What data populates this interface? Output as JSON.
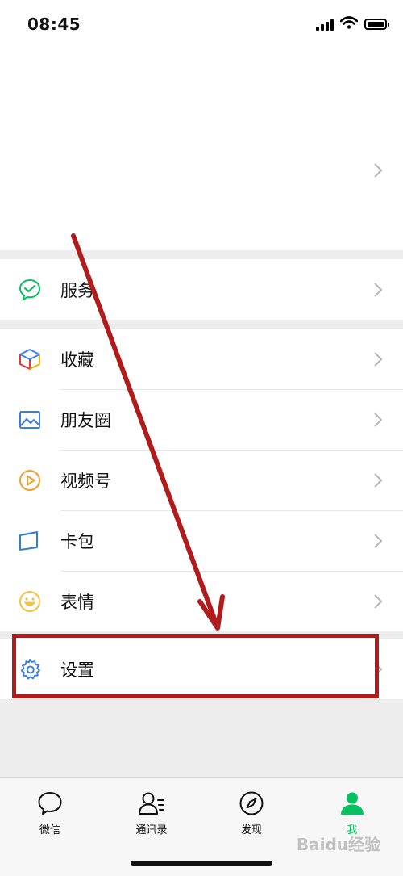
{
  "status_bar": {
    "time": "08:45"
  },
  "menu": {
    "services": {
      "label": "服务"
    },
    "favorites": {
      "label": "收藏"
    },
    "moments": {
      "label": "朋友圈"
    },
    "channels": {
      "label": "视频号"
    },
    "cards": {
      "label": "卡包"
    },
    "stickers": {
      "label": "表情"
    },
    "settings": {
      "label": "设置"
    }
  },
  "tabbar": {
    "items": [
      {
        "label": "微信",
        "icon": "chat-bubble-icon"
      },
      {
        "label": "通讯录",
        "icon": "contacts-icon"
      },
      {
        "label": "发现",
        "icon": "compass-icon"
      },
      {
        "label": "我",
        "icon": "person-icon",
        "active": true
      }
    ]
  },
  "annotation": {
    "color": "#b01c1c"
  },
  "colors": {
    "accent": "#07c160"
  },
  "watermark": "Baidu经验"
}
